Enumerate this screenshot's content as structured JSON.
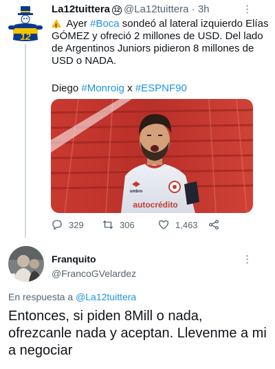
{
  "tweet1": {
    "display_name": "La12tuittera",
    "badge": "12",
    "handle": "@La12tuittera",
    "separator": "·",
    "time": "3h",
    "text": {
      "warning_icon": "warning-icon",
      "part1": " Ayer ",
      "hashtag_boca": "#Boca",
      "part2": " sondeó al lateral izquierdo Elías GÓMEZ y ofreció 2 millones de USD. Del lado de Argentinos Juniors pidieron 8 millones de USD o NADA."
    },
    "credit": {
      "prefix": "Diego ",
      "hashtag1": "#Monroig",
      "sep": " x ",
      "hashtag2": "#ESPNF90"
    },
    "photo": {
      "jersey_text": "autocrédito",
      "brand_text": "umbro"
    },
    "stats": {
      "replies": "329",
      "retweets": "306",
      "likes": "1,463"
    }
  },
  "tweet2": {
    "display_name": "Franquito",
    "handle": "@FrancoGVelardez",
    "reply_prefix": "En respuesta a ",
    "reply_to": "@La12tuittera",
    "text": "Entonces, si piden 8Mill o nada, ofrezcanle nada y aceptan. Llevenme a mi a negociar"
  },
  "colors": {
    "link": "#1b95e0",
    "muted": "#536471",
    "thread_line": "#cfd9de",
    "boca_blue": "#0b3a8c",
    "boca_yellow": "#f5c400"
  }
}
